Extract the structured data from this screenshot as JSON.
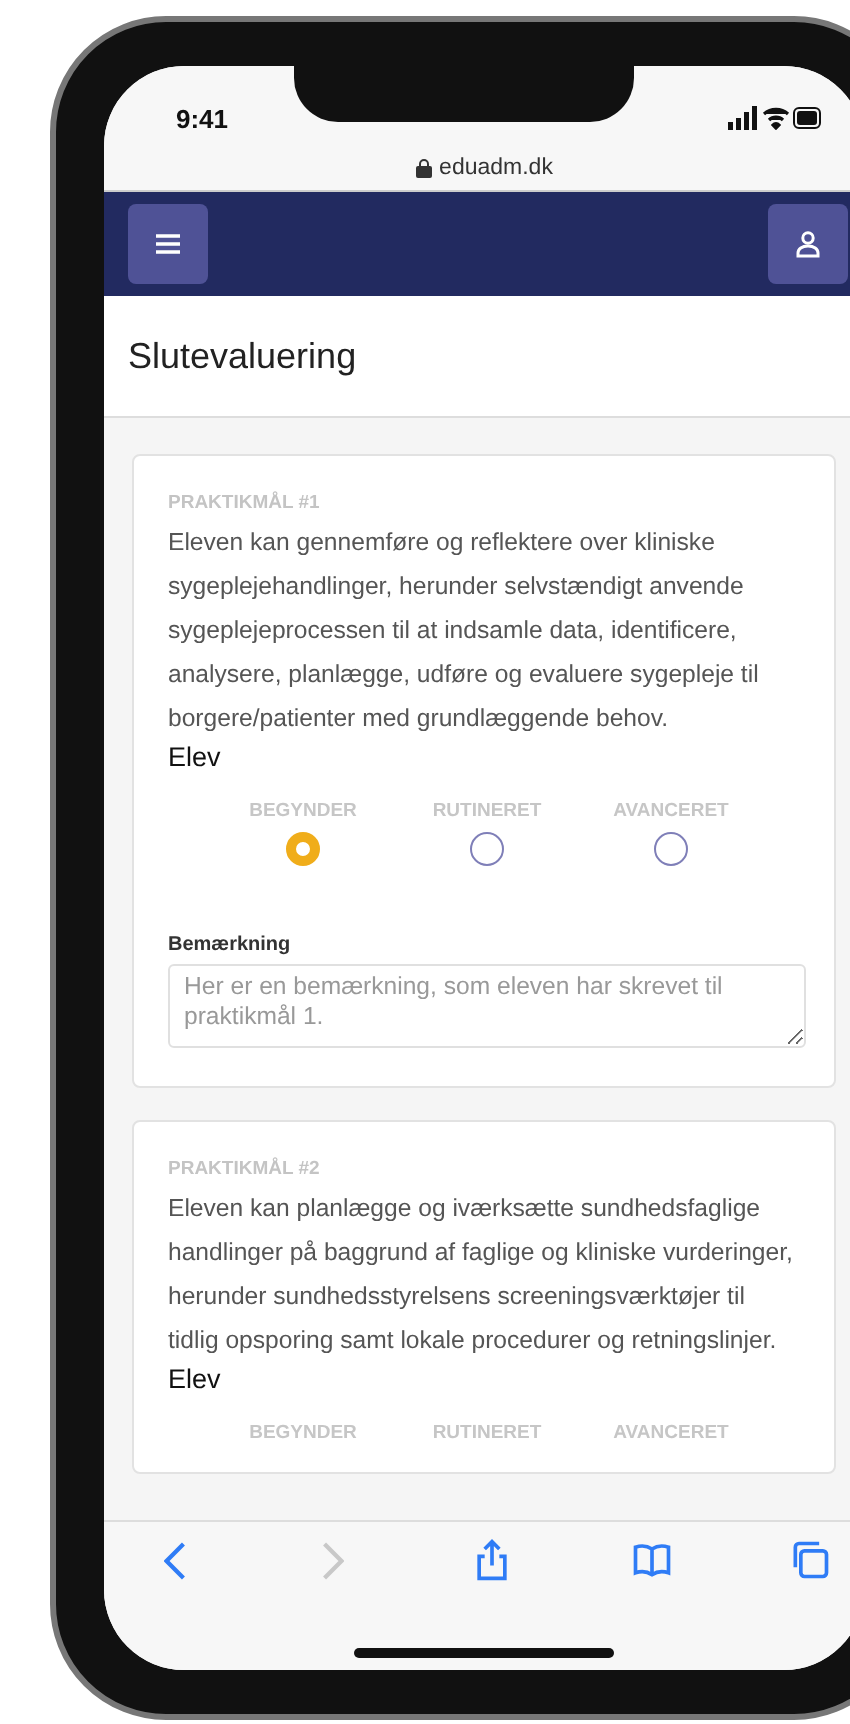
{
  "status_bar": {
    "time": "9:41"
  },
  "address_bar": {
    "url": "eduadm.dk"
  },
  "page_title": "Slutevaluering",
  "goals": [
    {
      "heading": "PRAKTIKMÅL #1",
      "text": "Eleven kan gennemføre og reflektere over kliniske sygeplejehandlinger, herunder selvstændigt anvende sygeplejeprocessen til at indsamle data, identificere, analysere, planlægge, udføre og evaluere sygepleje til borgere/patienter med grundlæggende behov.",
      "role": "Elev",
      "options": [
        {
          "label": "BEGYNDER",
          "selected": true
        },
        {
          "label": "RUTINERET",
          "selected": false
        },
        {
          "label": "AVANCERET",
          "selected": false
        }
      ],
      "remark": {
        "label": "Bemærkning",
        "value": "Her er en bemærkning, som eleven har skrevet til praktikmål 1."
      }
    },
    {
      "heading": "PRAKTIKMÅL #2",
      "text": "Eleven kan planlægge og iværksætte sundhedsfaglige handlinger på baggrund af faglige og kliniske vurderinger, herunder sundhedsstyrelsens screeningsværktøjer til tidlig opsporing samt lokale procedurer og retningslinjer.",
      "role": "Elev",
      "options": [
        {
          "label": "BEGYNDER"
        },
        {
          "label": "RUTINERET"
        },
        {
          "label": "AVANCERET"
        }
      ]
    }
  ],
  "toolbar": [
    {
      "kind": "back",
      "disabled": false
    },
    {
      "kind": "forward",
      "disabled": true
    },
    {
      "kind": "share",
      "disabled": false
    },
    {
      "kind": "bookmarks",
      "disabled": false
    },
    {
      "kind": "tabs",
      "disabled": false
    }
  ]
}
